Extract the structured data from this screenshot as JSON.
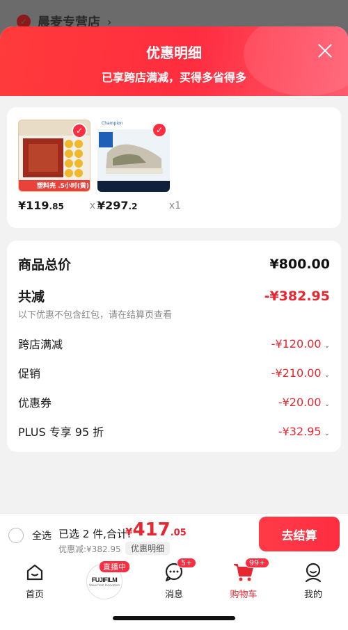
{
  "background": {
    "store_name": "晨麦专营店",
    "chevron": "›"
  },
  "sheet": {
    "title": "优惠明细",
    "subtitle": "已享跨店满减，买得多省得多"
  },
  "products": [
    {
      "price_main": "¥119",
      "price_dec": ".85",
      "qty": "x1",
      "thumb_text": "塑料壳 .5小时(黄)",
      "thumb_icon": "tea-box-image"
    },
    {
      "price_main": "¥297",
      "price_dec": ".2",
      "qty": "x1",
      "thumb_text": "Champion",
      "thumb_icon": "sneaker-image"
    }
  ],
  "summary": {
    "total_label": "商品总价",
    "total_value": "¥800.00",
    "reduce_label": "共减",
    "reduce_value": "-¥382.95",
    "note": "以下优惠不包含红包，请在结算页查看",
    "items": [
      {
        "label": "跨店满减",
        "value": "-¥120.00"
      },
      {
        "label": "促销",
        "value": "-¥210.00"
      },
      {
        "label": "优惠券",
        "value": "-¥20.00"
      },
      {
        "label": "PLUS 专享 95 折",
        "value": "-¥32.95"
      }
    ]
  },
  "checkout": {
    "select_all": "全选",
    "picked": "已选 2 件,合计:",
    "sum_yen": "¥",
    "sum_int": "417",
    "sum_dec": ".05",
    "discount": "优惠减:¥382.95",
    "detail": "优惠明细",
    "pay": "去结算"
  },
  "tabs": {
    "home": "首页",
    "live_badge": "直播中",
    "live_brand": "FUJIFILM",
    "live_tagline": "Value from Innovation",
    "msg": "消息",
    "msg_badge": "5+",
    "cart": "购物车",
    "cart_badge": "99+",
    "me": "我的"
  },
  "colors": {
    "accent": "#ff2d3f",
    "price_red": "#e8262f"
  }
}
